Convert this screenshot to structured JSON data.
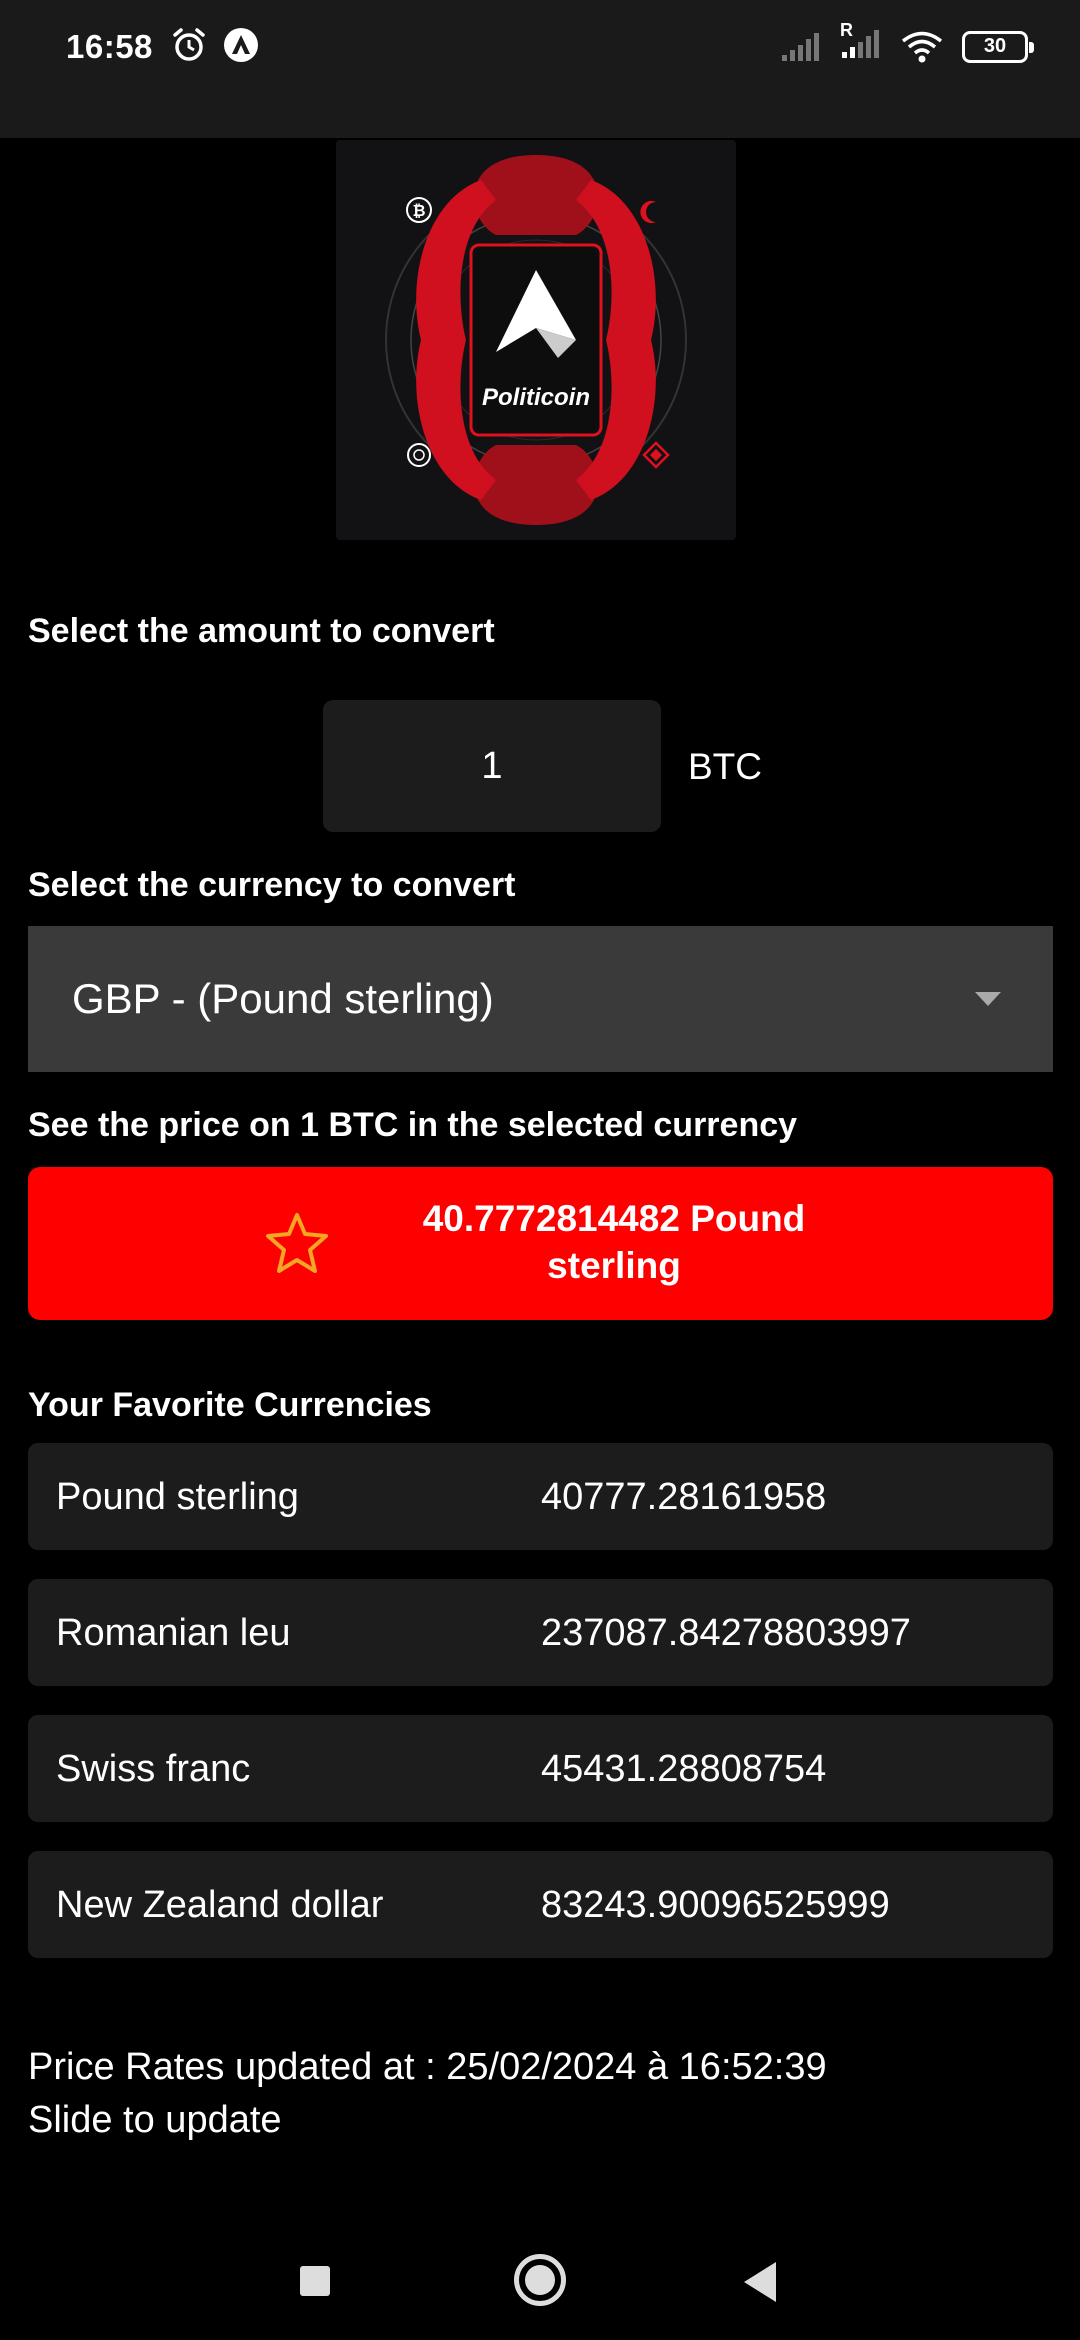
{
  "status_bar": {
    "time": "16:58",
    "battery": "30",
    "roaming_badge": "R"
  },
  "logo": {
    "text": "Politicoin",
    "colors": {
      "accent": "#e0101e",
      "background": "#121214"
    }
  },
  "amount_section": {
    "label": "Select the amount to convert",
    "value": "1",
    "unit": "BTC"
  },
  "currency_section": {
    "label": "Select the currency to convert",
    "selected": "GBP - (Pound sterling)"
  },
  "price_section": {
    "label": "See the price on 1 BTC in the selected currency",
    "line1": "40.7772814482 Pound",
    "line2": "sterling",
    "button_color": "#ff0000",
    "star_color": "#f5a623"
  },
  "favorites": {
    "title": "Your Favorite Currencies",
    "items": [
      {
        "name": "Pound sterling",
        "value": "40777.28161958"
      },
      {
        "name": "Romanian leu",
        "value": "237087.84278803997"
      },
      {
        "name": "Swiss franc",
        "value": "45431.28808754"
      },
      {
        "name": "New Zealand dollar",
        "value": "83243.90096525999"
      }
    ]
  },
  "footer": {
    "updated": "Price Rates updated at : 25/02/2024 à 16:52:39",
    "hint": "Slide to update"
  }
}
